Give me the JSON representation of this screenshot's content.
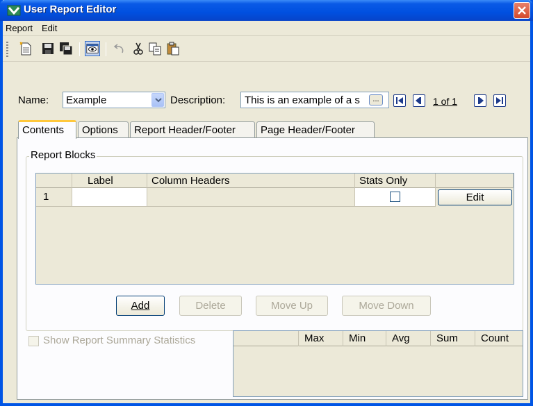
{
  "window": {
    "title": "User Report Editor"
  },
  "menu": {
    "report": "Report",
    "edit": "Edit"
  },
  "toolbar": {
    "buttons": [
      "new-report",
      "save",
      "save-as",
      "preview",
      "undo",
      "cut",
      "copy",
      "paste"
    ]
  },
  "form": {
    "name_label": "Name:",
    "name_value": "Example",
    "description_label": "Description:",
    "description_value": "This is an example of a s",
    "description_more": "...",
    "page_indicator": "1 of 1"
  },
  "tabs": [
    {
      "label": "Contents",
      "active": true
    },
    {
      "label": "Options",
      "active": false
    },
    {
      "label": "Report Header/Footer",
      "active": false
    },
    {
      "label": "Page Header/Footer",
      "active": false
    }
  ],
  "report_blocks": {
    "title": "Report Blocks",
    "columns": [
      "",
      "Label",
      "Column Headers",
      "Stats Only",
      ""
    ],
    "rows": [
      {
        "num": "1",
        "label": "",
        "column_headers": "",
        "stats_only": false,
        "action": "Edit"
      }
    ],
    "buttons": {
      "add": "Add",
      "delete": "Delete",
      "move_up": "Move Up",
      "move_down": "Move Down"
    }
  },
  "summary": {
    "checkbox_label": "Show Report Summary Statistics",
    "checked": false,
    "columns": [
      "",
      "Max",
      "Min",
      "Avg",
      "Sum",
      "Count"
    ]
  },
  "colors": {
    "title_bar": "#0055e5",
    "active_tab_accent": "#ffc83c",
    "close_button": "#d44a2c"
  }
}
